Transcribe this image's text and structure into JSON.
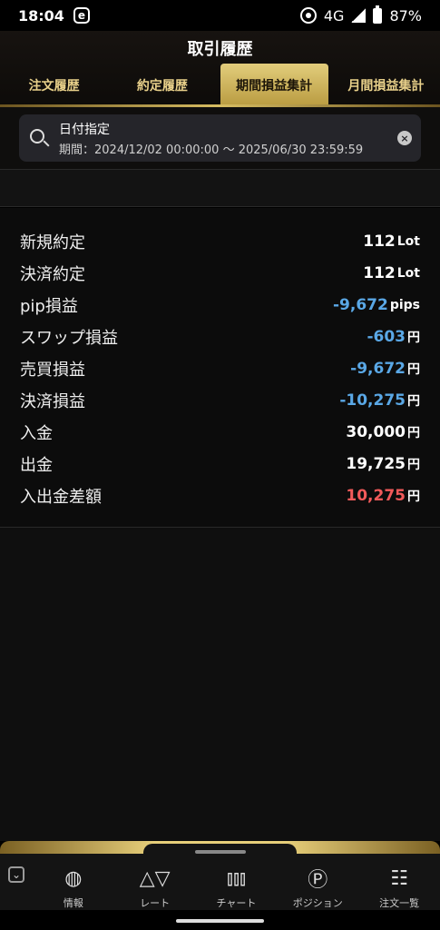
{
  "status": {
    "time": "18:04",
    "app_badge": "e",
    "network": "4G",
    "battery": "87%"
  },
  "header": {
    "title": "取引履歴",
    "tabs": [
      {
        "label": "注文履歴"
      },
      {
        "label": "約定履歴"
      },
      {
        "label": "期間損益集計"
      },
      {
        "label": "月間損益集計"
      }
    ],
    "active_tab": "期間損益集計"
  },
  "filter": {
    "label": "日付指定",
    "range": "期間：2024/12/02 00:00:00 ～ 2025/06/30 23:59:59",
    "clear_glyph": "×"
  },
  "summary": [
    {
      "label": "新規約定",
      "value": "112",
      "unit": "Lot",
      "tone": "normal"
    },
    {
      "label": "決済約定",
      "value": "112",
      "unit": "Lot",
      "tone": "normal"
    },
    {
      "label": "pip損益",
      "value": "-9,672",
      "unit": "pips",
      "tone": "neg"
    },
    {
      "label": "スワップ損益",
      "value": "-603",
      "unit": "円",
      "tone": "neg"
    },
    {
      "label": "売買損益",
      "value": "-9,672",
      "unit": "円",
      "tone": "neg"
    },
    {
      "label": "決済損益",
      "value": "-10,275",
      "unit": "円",
      "tone": "neg"
    },
    {
      "label": "入金",
      "value": "30,000",
      "unit": "円",
      "tone": "normal"
    },
    {
      "label": "出金",
      "value": "19,725",
      "unit": "円",
      "tone": "normal"
    },
    {
      "label": "入出金差額",
      "value": "10,275",
      "unit": "円",
      "tone": "pos"
    }
  ],
  "nav": {
    "items": [
      {
        "label": "情報",
        "icon": "globe-icon",
        "glyph": "◍"
      },
      {
        "label": "レート",
        "icon": "rate-triangles-icon",
        "glyph": "△▽"
      },
      {
        "label": "チャート",
        "icon": "candlestick-chart-icon",
        "glyph": "⫾⫾⫾"
      },
      {
        "label": "ポジション",
        "icon": "position-p-icon",
        "glyph": "Ⓟ"
      },
      {
        "label": "注文一覧",
        "icon": "order-list-icon",
        "glyph": "☷"
      }
    ],
    "collapse_glyph": "⌄"
  },
  "colors": {
    "accent_gold": "#d7bd62",
    "negative_blue": "#5aa8e6",
    "positive_red": "#f25a5a"
  }
}
